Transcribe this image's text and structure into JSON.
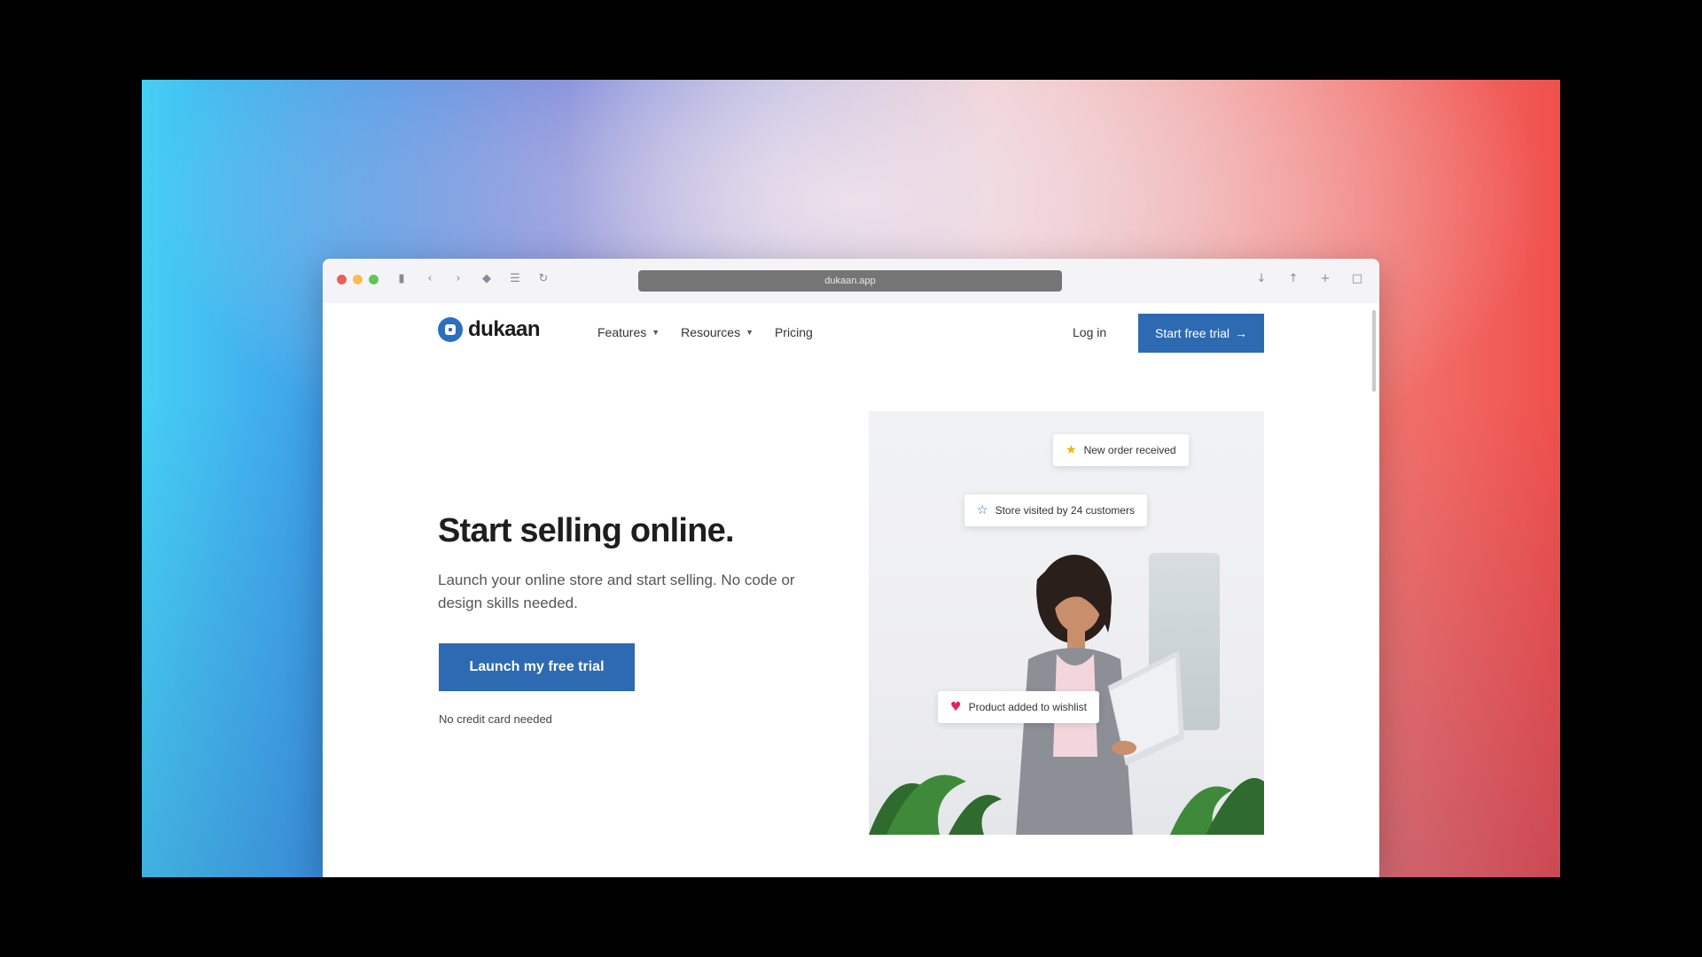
{
  "browser": {
    "url": "dukaan.app",
    "toolbar_icons": [
      "sidebar-icon",
      "back-icon",
      "forward-icon",
      "shield-icon",
      "reader-icon",
      "refresh-icon"
    ],
    "right_icons": [
      "download-icon",
      "share-icon",
      "new-tab-icon",
      "tabs-icon"
    ]
  },
  "nav": {
    "logo_text": "dukaan",
    "links": [
      {
        "label": "Features"
      },
      {
        "label": "Resources"
      },
      {
        "label": "Pricing"
      }
    ],
    "login_label": "Log in",
    "cta_label": "Start free trial"
  },
  "hero": {
    "title": "Start selling online.",
    "subtitle": "Launch your online store and start selling. No code or design skills needed.",
    "cta_label": "Launch my free trial",
    "note": "No credit card needed"
  },
  "visual": {
    "chips": [
      {
        "icon": "★",
        "text": "New order received"
      },
      {
        "icon": "☆",
        "text": "Store visited by 24 customers"
      },
      {
        "icon": "♥",
        "text": "Product added to wishlist"
      }
    ]
  },
  "colors": {
    "brand": "#2e6ab1",
    "wallpaper_left": "#46cff5",
    "wallpaper_right": "#f0504c"
  }
}
